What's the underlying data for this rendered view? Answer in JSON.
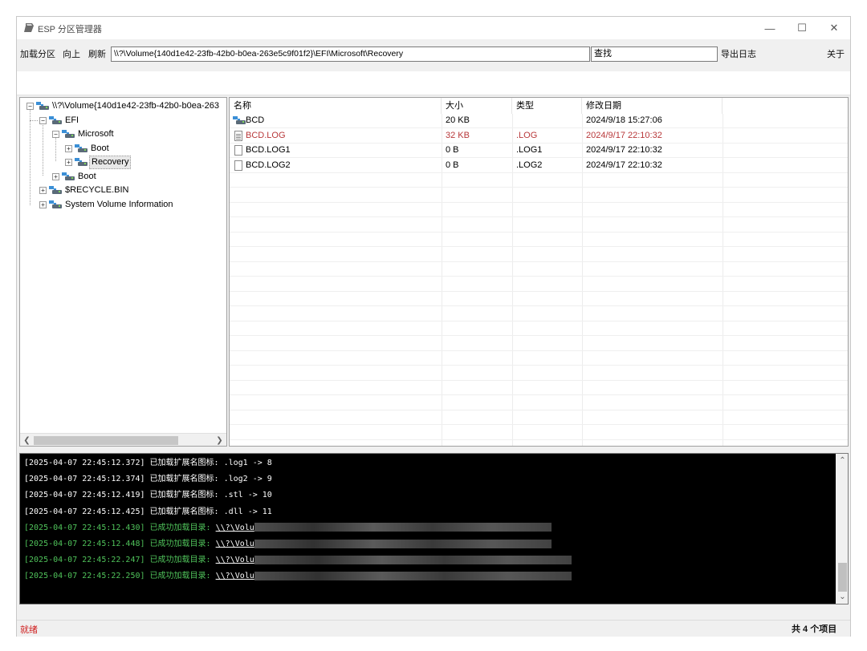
{
  "window": {
    "title": "ESP 分区管理器",
    "controls": {
      "minimize": "—",
      "maximize": "☐",
      "close": "✕"
    }
  },
  "toolbar": {
    "load_partition": "加载分区",
    "up": "向上",
    "refresh": "刷新",
    "path_value": "\\\\?\\Volume{140d1e42-23fb-42b0-b0ea-263e5c9f01f2}\\EFI\\Microsoft\\Recovery",
    "search_value": "查找",
    "export_log": "导出日志",
    "about": "关于"
  },
  "tree": {
    "root": "\\\\?\\Volume{140d1e42-23fb-42b0-b0ea-263",
    "efi": "EFI",
    "microsoft": "Microsoft",
    "ms_boot": "Boot",
    "recovery": "Recovery",
    "efi_boot": "Boot",
    "recycle": "$RECYCLE.BIN",
    "svi": "System Volume Information",
    "selected": "Recovery"
  },
  "list": {
    "columns": [
      "名称",
      "大小",
      "类型",
      "修改日期"
    ],
    "rows": [
      {
        "name": "BCD",
        "size": "20 KB",
        "type": "",
        "date": "2024/9/18 15:27:06",
        "icon": "drive-icon",
        "highlight": false
      },
      {
        "name": "BCD.LOG",
        "size": "32 KB",
        "type": ".LOG",
        "date": "2024/9/17 22:10:32",
        "icon": "log-file-icon",
        "highlight": true
      },
      {
        "name": "BCD.LOG1",
        "size": "0 B",
        "type": ".LOG1",
        "date": "2024/9/17 22:10:32",
        "icon": "file-icon",
        "highlight": false
      },
      {
        "name": "BCD.LOG2",
        "size": "0 B",
        "type": ".LOG2",
        "date": "2024/9/17 22:10:32",
        "icon": "file-icon",
        "highlight": false
      }
    ]
  },
  "console": {
    "lines": [
      {
        "ts": "[2025-04-07 22:45:12.372]",
        "msg": "已加载扩展名图标: .log1 -> 8",
        "kind": "info"
      },
      {
        "ts": "[2025-04-07 22:45:12.374]",
        "msg": "已加载扩展名图标: .log2 -> 9",
        "kind": "info"
      },
      {
        "ts": "[2025-04-07 22:45:12.419]",
        "msg": "已加载扩展名图标: .stl -> 10",
        "kind": "info"
      },
      {
        "ts": "[2025-04-07 22:45:12.425]",
        "msg": "已加载扩展名图标: .dll -> 11",
        "kind": "info"
      },
      {
        "ts": "[2025-04-07 22:45:12.430]",
        "msg": "已成功加载目录:",
        "path": "\\\\?\\Volu",
        "kind": "ok"
      },
      {
        "ts": "[2025-04-07 22:45:12.448]",
        "msg": "已成功加载目录:",
        "path": "\\\\?\\Volu",
        "kind": "ok"
      },
      {
        "ts": "[2025-04-07 22:45:22.247]",
        "msg": "已成功加载目录:",
        "path": "\\\\?\\Volu",
        "kind": "ok"
      },
      {
        "ts": "[2025-04-07 22:45:22.250]",
        "msg": "已成功加载目录:",
        "path": "\\\\?\\Volu",
        "kind": "ok"
      }
    ]
  },
  "status": {
    "left": "就绪",
    "right": "共 4 个项目"
  },
  "colors": {
    "highlight_text": "#b8383a",
    "console_ok": "#4fc25a",
    "status_ready": "#d02020"
  }
}
